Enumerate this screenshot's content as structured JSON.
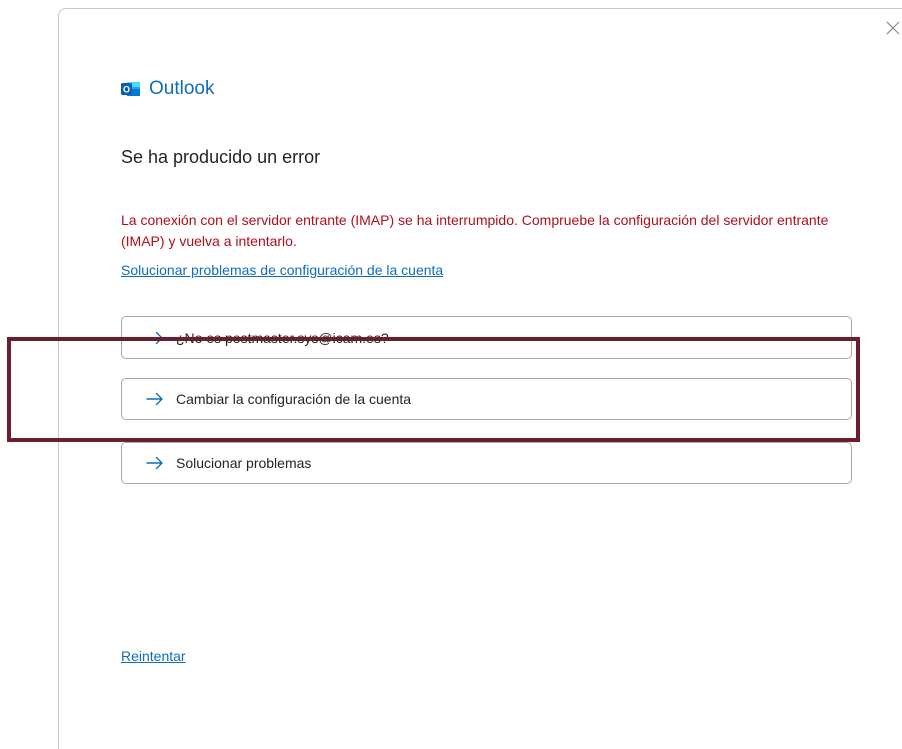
{
  "app": {
    "name": "Outlook",
    "logo_letter": "O"
  },
  "dialog": {
    "title": "Se ha producido un error",
    "error_message": "La conexión con el servidor entrante (IMAP) se ha interrumpido. Compruebe la configuración del servidor entrante (IMAP) y vuelva a intentarlo.",
    "troubleshoot_link": "Solucionar problemas de configuración de la cuenta",
    "options": [
      {
        "label": "¿No es postmaster.sys@icam.es?",
        "icon": "arrow-right-icon"
      },
      {
        "label": "Cambiar la configuración de la cuenta",
        "icon": "arrow-right-icon"
      },
      {
        "label": "Solucionar problemas",
        "icon": "arrow-right-icon"
      }
    ],
    "retry_link": "Reintentar",
    "close_icon": "close-icon"
  },
  "colors": {
    "accent": "#0f6cbd",
    "error": "#b10e1c",
    "highlight_border": "#6b1f2e"
  }
}
